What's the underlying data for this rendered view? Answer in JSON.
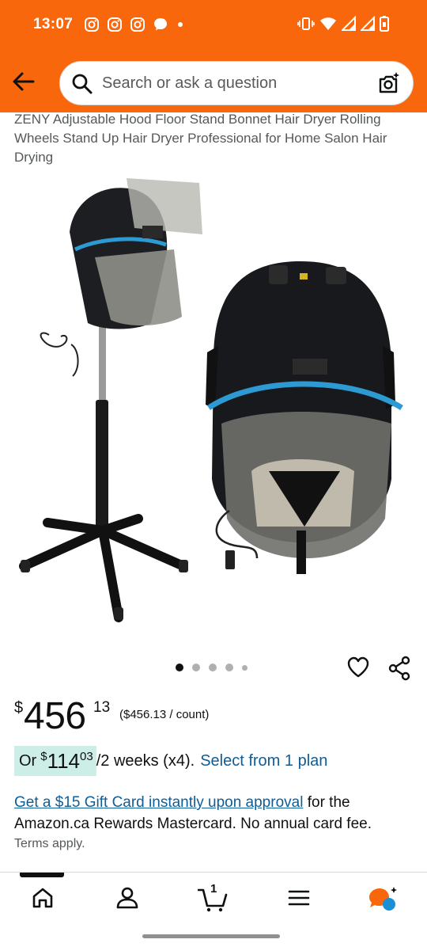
{
  "status_bar": {
    "time": "13:07",
    "left_icons": [
      "instagram-icon",
      "instagram-icon",
      "instagram-icon",
      "chat-bubble-icon",
      "dot-icon"
    ],
    "right_icons": [
      "vibrate-icon",
      "wifi-icon",
      "signal-icon",
      "signal-icon",
      "battery-icon"
    ]
  },
  "header": {
    "back_icon": "arrow-left-icon",
    "search_placeholder": "Search or ask a question",
    "camera_icon": "camera-search-icon"
  },
  "product": {
    "title": "ZENY Adjustable Hood Floor Stand Bonnet Hair Dryer Rolling Wheels Stand Up Hair Dryer Professional for Home Salon Hair Drying",
    "image_count": 5,
    "active_image": 1
  },
  "price": {
    "currency": "$",
    "whole": "456",
    "fraction": "13",
    "unit_price": "($456.13 / count)"
  },
  "installment": {
    "prefix": "Or",
    "currency": "$",
    "whole": "114",
    "fraction": "03",
    "period": "/2 weeks (x4).",
    "link": "Select from 1 plan"
  },
  "promo": {
    "link": "Get a $15 Gift Card instantly upon approval",
    "text": "for the Amazon.ca Rewards Mastercard. No annual card fee.",
    "terms": "Terms apply."
  },
  "bottom_nav": {
    "items": [
      "home-icon",
      "account-icon",
      "cart-icon",
      "menu-icon",
      "rufus-icon"
    ],
    "cart_count": "1"
  },
  "colors": {
    "header_bg": "#f9670d",
    "link": "#0d5d99",
    "installment_bg": "#cdeee6"
  }
}
